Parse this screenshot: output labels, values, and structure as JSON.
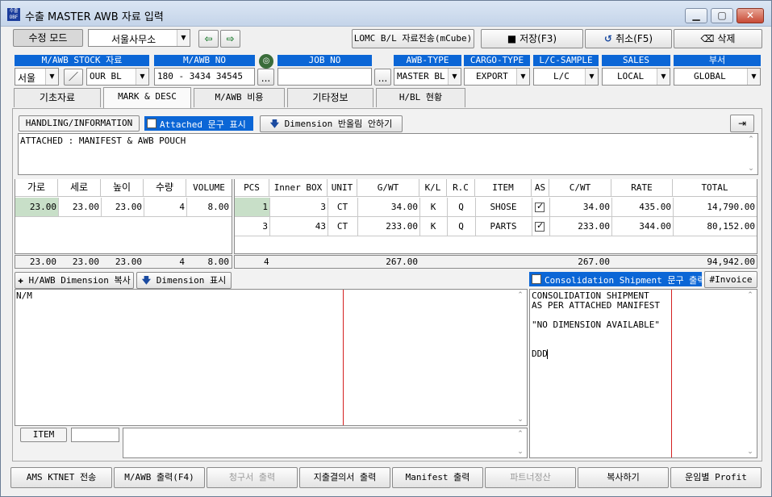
{
  "window": {
    "title": "수출 MASTER AWB 자료 입력",
    "app_icon_text": "수출 OBF"
  },
  "toolbar": {
    "mode_label": "수정 모드",
    "office": "서울사무소",
    "prev_icon": "arrow-left-icon",
    "next_icon": "arrow-right-icon",
    "lomc_label": "LOMC B/L 자료전송(mCube)",
    "save_label": "저장(F3)",
    "cancel_label": "취소(F5)",
    "delete_label": "삭제"
  },
  "fields": {
    "stock_header": "M/AWB STOCK 자료",
    "stock_region": "서울",
    "stock_type": "OUR BL",
    "mawb_header": "M/AWB NO",
    "mawb_no": "180 - 3434 34545",
    "job_header": "JOB NO",
    "job_no": "",
    "awb_type_header": "AWB-TYPE",
    "awb_type": "MASTER BL",
    "cargo_type_header": "CARGO-TYPE",
    "cargo_type": "EXPORT",
    "lc_header": "L/C-SAMPLE",
    "lc": "L/C",
    "sales_header": "SALES",
    "sales": "LOCAL",
    "dept_header": "부서",
    "dept": "GLOBAL",
    "ellipsis": "..."
  },
  "tabs": [
    {
      "label": "기초자료"
    },
    {
      "label": "MARK & DESC"
    },
    {
      "label": "M/AWB 비용"
    },
    {
      "label": "기타정보"
    },
    {
      "label": "H/BL 현황"
    }
  ],
  "handling": {
    "label": "HANDLING/INFORMATION",
    "attached_label": "Attached 문구 표시",
    "dimension_round_label": "Dimension 반올림 안하기",
    "text": "ATTACHED : MANIFEST & AWB POUCH"
  },
  "dim_table": {
    "headers": [
      "가로",
      "세로",
      "높이",
      "수량",
      "VOLUME"
    ],
    "rows": [
      [
        "23.00",
        "23.00",
        "23.00",
        "4",
        "8.00"
      ]
    ],
    "totals": [
      "23.00",
      "23.00",
      "23.00",
      "4",
      "8.00"
    ]
  },
  "pcs_table": {
    "headers": [
      "PCS",
      "Inner BOX",
      "UNIT",
      "G/WT",
      "K/L",
      "R.C",
      "ITEM",
      "AS",
      "C/WT",
      "RATE",
      "TOTAL"
    ],
    "rows": [
      [
        "1",
        "3",
        "CT",
        "34.00",
        "K",
        "Q",
        "SHOSE",
        true,
        "34.00",
        "435.00",
        "14,790.00"
      ],
      [
        "3",
        "43",
        "CT",
        "233.00",
        "K",
        "Q",
        "PARTS",
        true,
        "233.00",
        "344.00",
        "80,152.00"
      ]
    ],
    "totals": {
      "pcs": "4",
      "gwt": "267.00",
      "cwt": "267.00",
      "total": "94,942.00"
    }
  },
  "buttons_mid": {
    "copy_dim": "H/AWB Dimension 복사",
    "show_dim": "Dimension 표시",
    "consol_label": "Consolidation Shipment 문구 출력",
    "invoice": "#Invoice"
  },
  "marks_text": "N/M",
  "desc_lines": [
    "CONSOLIDATION SHIPMENT",
    "AS PER ATTACHED MANIFEST",
    "",
    "\"NO DIMENSION AVAILABLE\"",
    "",
    "",
    "DDD"
  ],
  "item": {
    "label": "ITEM",
    "value": ""
  },
  "footer": [
    {
      "label": "AMS KTNET 전송",
      "disabled": false
    },
    {
      "label": "M/AWB 출력(F4)",
      "disabled": false
    },
    {
      "label": "청구서 출력",
      "disabled": true
    },
    {
      "label": "지출결의서 출력",
      "disabled": false
    },
    {
      "label": "Manifest 출력",
      "disabled": false
    },
    {
      "label": "파트너정산",
      "disabled": true
    },
    {
      "label": "복사하기",
      "disabled": false
    },
    {
      "label": "운임별 Profit",
      "disabled": false
    }
  ],
  "colors": {
    "header_blue": "#0b66d6",
    "highlight_green": "#c8dfc8",
    "red_margin": "#d42020"
  }
}
